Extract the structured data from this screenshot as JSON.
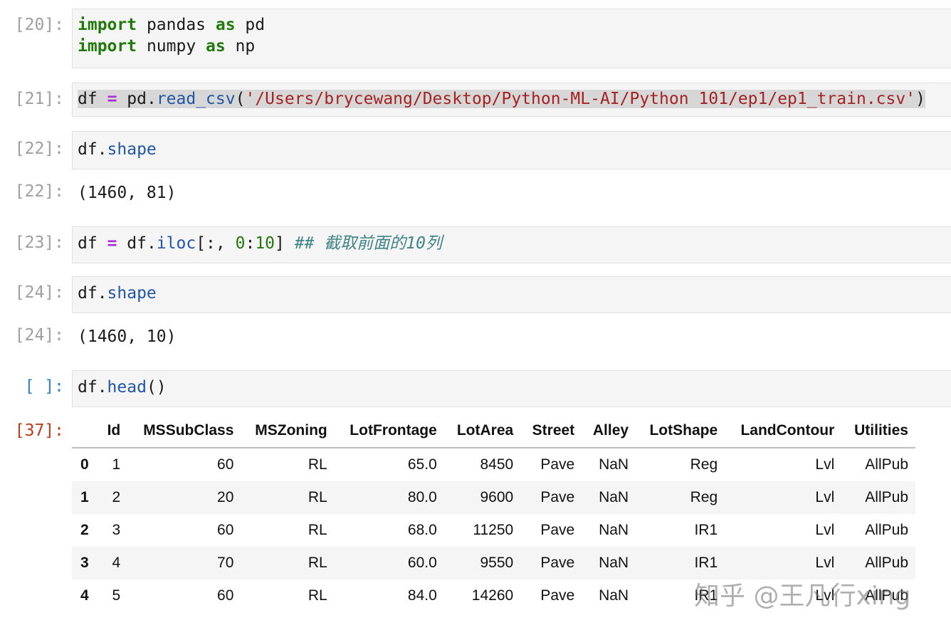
{
  "cells": [
    {
      "prompt": "[20]:",
      "line1": {
        "k1": "import",
        "t1": " pandas ",
        "k2": "as",
        "t2": " pd"
      },
      "line2": {
        "k1": "import",
        "t1": " numpy ",
        "k2": "as",
        "t2": " np"
      }
    },
    {
      "prompt": "[21]:",
      "df": "df",
      "eq": "=",
      "pd": " pd.",
      "fn": "read_csv",
      "open": "(",
      "str": "'/Users/brycewang/Desktop/Python-ML-AI/Python 101/ep1/ep1_train.csv'",
      "close": ")"
    },
    {
      "prompt": "[22]:",
      "obj": "df.",
      "attr": "shape"
    },
    {
      "prompt": "[22]:",
      "output": "(1460, 81)"
    },
    {
      "prompt": "[23]:",
      "df": "df",
      "eq": "=",
      "t1": " df.",
      "fn": "iloc",
      "t2": "[:, ",
      "n1": "0",
      "colon": ":",
      "n2": "10",
      "t3": "] ",
      "comment": "## 截取前面的10列"
    },
    {
      "prompt": "[24]:",
      "obj": "df.",
      "attr": "shape"
    },
    {
      "prompt": "[24]:",
      "output": "(1460, 10)"
    },
    {
      "prompt": "[ ]:",
      "obj": "df.",
      "attr": "head",
      "paren": "()"
    },
    {
      "prompt": "[37]:"
    }
  ],
  "table": {
    "columns": [
      "",
      "Id",
      "MSSubClass",
      "MSZoning",
      "LotFrontage",
      "LotArea",
      "Street",
      "Alley",
      "LotShape",
      "LandContour",
      "Utilities"
    ],
    "rows": [
      [
        "0",
        "1",
        "60",
        "RL",
        "65.0",
        "8450",
        "Pave",
        "NaN",
        "Reg",
        "Lvl",
        "AllPub"
      ],
      [
        "1",
        "2",
        "20",
        "RL",
        "80.0",
        "9600",
        "Pave",
        "NaN",
        "Reg",
        "Lvl",
        "AllPub"
      ],
      [
        "2",
        "3",
        "60",
        "RL",
        "68.0",
        "11250",
        "Pave",
        "NaN",
        "IR1",
        "Lvl",
        "AllPub"
      ],
      [
        "3",
        "4",
        "70",
        "RL",
        "60.0",
        "9550",
        "Pave",
        "NaN",
        "IR1",
        "Lvl",
        "AllPub"
      ],
      [
        "4",
        "5",
        "60",
        "RL",
        "84.0",
        "14260",
        "Pave",
        "NaN",
        "IR1",
        "Lvl",
        "AllPub"
      ]
    ]
  },
  "watermark": "知乎 @王凡行xing",
  "colors": {
    "keyword": "#1f7a0a",
    "operator": "#a82cd4",
    "function": "#2155a6",
    "string": "#a52222",
    "comment": "#3f8486",
    "prompt_in": "#307fc1",
    "prompt_out": "#bd3b16"
  }
}
